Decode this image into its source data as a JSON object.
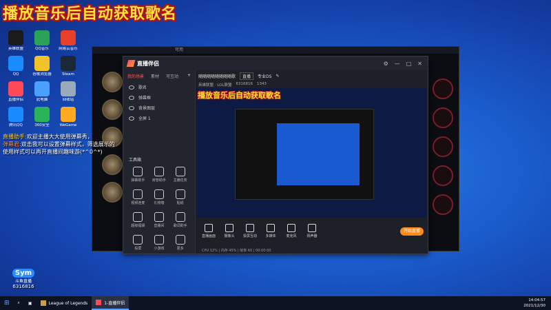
{
  "overlay": {
    "title": "播放音乐后自动获取歌名"
  },
  "desktop_icons": [
    {
      "label": "英雄联盟",
      "color": "#1b1b1b"
    },
    {
      "label": "QQ音乐",
      "color": "#2aa35a"
    },
    {
      "label": "网易云音乐",
      "color": "#e8402a"
    },
    {
      "label": "QQ",
      "color": "#1a8cff"
    },
    {
      "label": "谷歌浏览器",
      "color": "#f2c22a"
    },
    {
      "label": "Steam",
      "color": "#1b2838"
    },
    {
      "label": "直播伴侣",
      "color": "#ff4a5a"
    },
    {
      "label": "此电脑",
      "color": "#4aa0ff"
    },
    {
      "label": "回收站",
      "color": "#9ab"
    },
    {
      "label": "腾讯QQ",
      "color": "#1a8cff"
    },
    {
      "label": "360安全",
      "color": "#2ab35a"
    },
    {
      "label": "WeGame",
      "color": "#ffaa22"
    }
  ],
  "lol_window": {
    "title": "可用"
  },
  "app": {
    "title": "直播伴侣",
    "tabs": [
      "我的场景",
      "素材",
      "可互动"
    ],
    "scenes": [
      "歌名",
      "弹幕框",
      "背景图层",
      "全屏 1"
    ],
    "tools_header": "工具箱",
    "tools": [
      "弹幕助手",
      "房管助手",
      "主播任务",
      "视频连麦",
      "礼物墙",
      "贴纸",
      "超级福袋",
      "直播间",
      "歌词助手",
      "投屏",
      "小游戏",
      "更多"
    ],
    "preview_header": {
      "room_title": "随随随随随随随随歌",
      "room_chip": "直播",
      "category": "专业DS",
      "game_mode": "英雄联盟 · LOL联盟",
      "fans": "6316816",
      "likes": "1343"
    },
    "preview_caption": "播放音乐后自动获取歌名",
    "bottom_buttons": [
      "直播画面",
      "摄像头",
      "投屏互动",
      "多媒体",
      "麦克风",
      "扬声器"
    ],
    "start_live": "开始直播",
    "status_bar": "CPU 12% | 内存 45% | 帧率 60 | 00:00:00"
  },
  "chat": {
    "line1_name": "直播助手:",
    "line1_text": "欢迎主播大大使用弹幕秀，",
    "line2_name": "弹幕君:",
    "line2_text": "双击我可以设置弹幕样式，筛选展示的",
    "line3_text": "使用样式可以再开直播间趣味游(*^0^*)"
  },
  "watermark": {
    "badge": "Sym",
    "sub": "斗鱼直播",
    "room_id": "6316816"
  },
  "taskbar": {
    "app1": "League of Legends",
    "app2": "1-直播伴侣",
    "time": "14:04:57",
    "date": "2021/12/30"
  }
}
